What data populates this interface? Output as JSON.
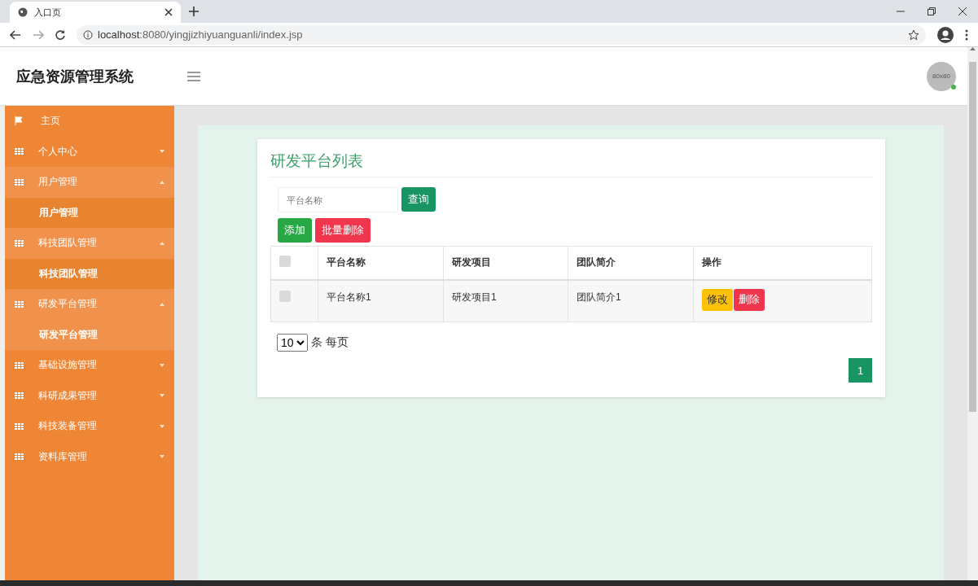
{
  "browser": {
    "tab_title": "入口页",
    "url_host": "localhost",
    "url_rest": ":8080/yingjizhiyuanguanli/index.jsp"
  },
  "header": {
    "title": "应急资源管理系统",
    "avatar_text": "80x80"
  },
  "sidebar": {
    "items": [
      {
        "kind": "link",
        "label": "主页"
      },
      {
        "kind": "group",
        "label": "个人中心",
        "expanded": false
      },
      {
        "kind": "group",
        "label": "用户管理",
        "expanded": true,
        "children": [
          {
            "label": "用户管理",
            "selected": false
          }
        ]
      },
      {
        "kind": "group",
        "label": "科技团队管理",
        "expanded": true,
        "children": [
          {
            "label": "科技团队管理",
            "selected": false
          }
        ]
      },
      {
        "kind": "group",
        "label": "研发平台管理",
        "expanded": true,
        "children": [
          {
            "label": "研发平台管理",
            "selected": true
          }
        ]
      },
      {
        "kind": "group",
        "label": "基础设施管理",
        "expanded": false
      },
      {
        "kind": "group",
        "label": "科研成果管理",
        "expanded": false
      },
      {
        "kind": "group",
        "label": "科技装备管理",
        "expanded": false
      },
      {
        "kind": "group",
        "label": "资料库管理",
        "expanded": false
      }
    ]
  },
  "card": {
    "title": "研发平台列表",
    "search": {
      "placeholder": "平台名称",
      "button": "查询"
    },
    "add_button": "添加",
    "batch_delete_button": "批量删除",
    "table": {
      "select_all_checked": false,
      "columns": [
        "平台名称",
        "研发项目",
        "团队简介",
        "操作"
      ],
      "rows": [
        {
          "checked": false,
          "cells": [
            "平台名称1",
            "研发项目1",
            "团队简介1"
          ],
          "edit": "修改",
          "delete": "删除"
        }
      ]
    },
    "page_size": "10",
    "page_size_suffix": "条 每页",
    "pages": [
      {
        "label": "1",
        "selected": true
      }
    ]
  }
}
